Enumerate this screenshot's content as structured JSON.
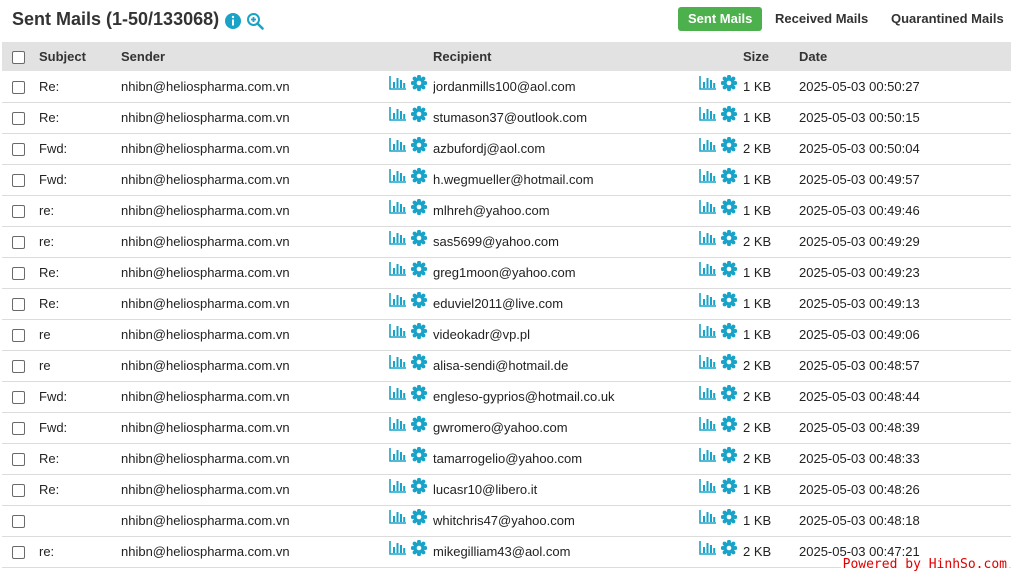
{
  "header": {
    "title": "Sent Mails (1-50/133068)",
    "tabs": [
      {
        "label": "Sent Mails",
        "active": true
      },
      {
        "label": "Received Mails",
        "active": false
      },
      {
        "label": "Quarantined Mails",
        "active": false
      }
    ]
  },
  "icons": {
    "info": "info-circle-icon",
    "zoom": "zoom-in-icon",
    "stats": "bar-chart-icon",
    "settings": "gear-icon"
  },
  "colors": {
    "accent": "#1aa3c8",
    "active_tab": "#4cb14c",
    "header_row": "#e2e2e2",
    "watermark": "#e00000"
  },
  "table": {
    "columns": [
      "Subject",
      "Sender",
      "Recipient",
      "Size",
      "Date"
    ],
    "rows": [
      {
        "subject": "Re:",
        "sender": "nhibn@heliospharma.com.vn",
        "recipient": "jordanmills100@aol.com",
        "size": "1 KB",
        "date": "2025-05-03 00:50:27"
      },
      {
        "subject": "Re:",
        "sender": "nhibn@heliospharma.com.vn",
        "recipient": "stumason37@outlook.com",
        "size": "1 KB",
        "date": "2025-05-03 00:50:15"
      },
      {
        "subject": "Fwd:",
        "sender": "nhibn@heliospharma.com.vn",
        "recipient": "azbufordj@aol.com",
        "size": "2 KB",
        "date": "2025-05-03 00:50:04"
      },
      {
        "subject": "Fwd:",
        "sender": "nhibn@heliospharma.com.vn",
        "recipient": "h.wegmueller@hotmail.com",
        "size": "1 KB",
        "date": "2025-05-03 00:49:57"
      },
      {
        "subject": "re:",
        "sender": "nhibn@heliospharma.com.vn",
        "recipient": "mlhreh@yahoo.com",
        "size": "1 KB",
        "date": "2025-05-03 00:49:46"
      },
      {
        "subject": "re:",
        "sender": "nhibn@heliospharma.com.vn",
        "recipient": "sas5699@yahoo.com",
        "size": "2 KB",
        "date": "2025-05-03 00:49:29"
      },
      {
        "subject": "Re:",
        "sender": "nhibn@heliospharma.com.vn",
        "recipient": "greg1moon@yahoo.com",
        "size": "1 KB",
        "date": "2025-05-03 00:49:23"
      },
      {
        "subject": "Re:",
        "sender": "nhibn@heliospharma.com.vn",
        "recipient": "eduviel2011@live.com",
        "size": "1 KB",
        "date": "2025-05-03 00:49:13"
      },
      {
        "subject": "re",
        "sender": "nhibn@heliospharma.com.vn",
        "recipient": "videokadr@vp.pl",
        "size": "1 KB",
        "date": "2025-05-03 00:49:06"
      },
      {
        "subject": "re",
        "sender": "nhibn@heliospharma.com.vn",
        "recipient": "alisa-sendi@hotmail.de",
        "size": "2 KB",
        "date": "2025-05-03 00:48:57"
      },
      {
        "subject": "Fwd:",
        "sender": "nhibn@heliospharma.com.vn",
        "recipient": "engleso-gyprios@hotmail.co.uk",
        "size": "2 KB",
        "date": "2025-05-03 00:48:44"
      },
      {
        "subject": "Fwd:",
        "sender": "nhibn@heliospharma.com.vn",
        "recipient": "gwromero@yahoo.com",
        "size": "2 KB",
        "date": "2025-05-03 00:48:39"
      },
      {
        "subject": "Re:",
        "sender": "nhibn@heliospharma.com.vn",
        "recipient": "tamarrogelio@yahoo.com",
        "size": "2 KB",
        "date": "2025-05-03 00:48:33"
      },
      {
        "subject": "Re:",
        "sender": "nhibn@heliospharma.com.vn",
        "recipient": "lucasr10@libero.it",
        "size": "1 KB",
        "date": "2025-05-03 00:48:26"
      },
      {
        "subject": "",
        "sender": "nhibn@heliospharma.com.vn",
        "recipient": "whitchris47@yahoo.com",
        "size": "1 KB",
        "date": "2025-05-03 00:48:18"
      },
      {
        "subject": "re:",
        "sender": "nhibn@heliospharma.com.vn",
        "recipient": "mikegilliam43@aol.com",
        "size": "2 KB",
        "date": "2025-05-03 00:47:21"
      }
    ]
  },
  "watermark": "Powered by HinhSo.com"
}
